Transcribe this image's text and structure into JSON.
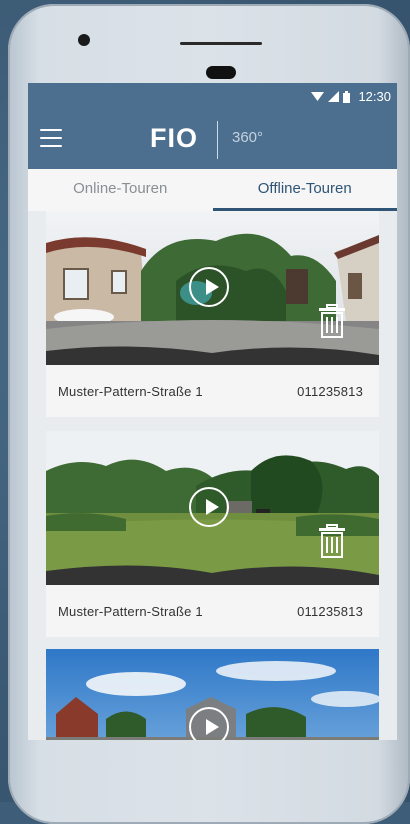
{
  "status_bar": {
    "time": "12:30"
  },
  "app_bar": {
    "logo": "FIO",
    "logo_sub": "360°"
  },
  "tabs": [
    {
      "label": "Online-Touren",
      "active": false
    },
    {
      "label": "Offline-Touren",
      "active": true
    }
  ],
  "tours": [
    {
      "name": "Muster-Pattern-Straße 1",
      "number": "011235813"
    },
    {
      "name": "Muster-Pattern-Straße 1",
      "number": "011235813"
    },
    {
      "name": "",
      "number": ""
    }
  ],
  "colors": {
    "accent": "#2f5475",
    "appbar": "#4d6f8f",
    "tab_inactive": "#8a8f94"
  },
  "icons": [
    "menu-icon",
    "wifi-icon",
    "signal-icon",
    "battery-icon",
    "play-icon",
    "trash-icon"
  ]
}
